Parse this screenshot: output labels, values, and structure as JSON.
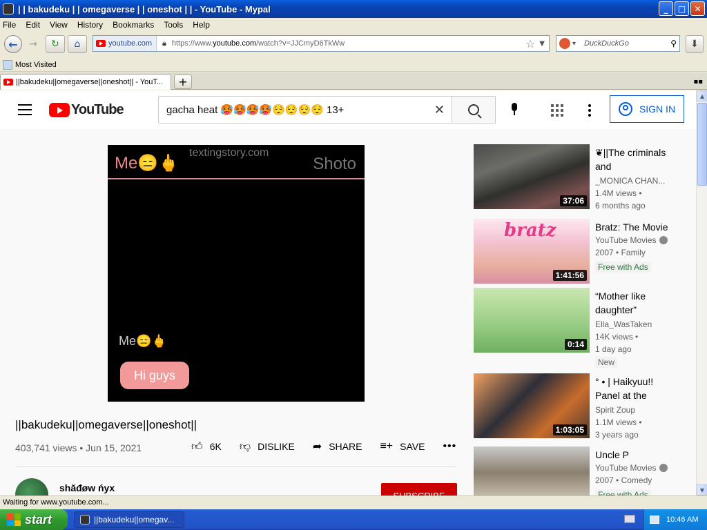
{
  "window": {
    "title": "| | bakudeku | | omegaverse | | oneshot | |  - YouTube - Mypal",
    "buttons": {
      "minimize": "_",
      "maximize": "□",
      "close": "✕"
    }
  },
  "menu": [
    "File",
    "Edit",
    "View",
    "History",
    "Bookmarks",
    "Tools",
    "Help"
  ],
  "nav": {
    "site_chip": "youtube.com",
    "url_prefix": "https://www.",
    "url_domain": "youtube.com",
    "url_path": "/watch?v=JJCmyD6TkWw",
    "search_placeholder": "DuckDuckGo"
  },
  "bookmarks": {
    "most_visited": "Most Visited"
  },
  "tabs": [
    {
      "label": "||bakudeku||omegaverse||oneshot|| - YouT..."
    }
  ],
  "youtube": {
    "logo_text": "YouTube",
    "search_query": "gacha heat 🥵🥵🥵🥵😌😌😌😌 13+",
    "sign_in": "SIGN IN"
  },
  "player": {
    "me_top": "Me😑🖕",
    "watermark": "textingstory.com",
    "contact": "Shoto",
    "me_mid": "Me😑🖕",
    "bubble": "Hi guys"
  },
  "video": {
    "title": "||bakudeku||omegaverse||oneshot||",
    "meta": "403,741 views • Jun 15, 2021",
    "likes": "6K",
    "dislike": "DISLIKE",
    "share": "SHARE",
    "save": "SAVE",
    "more": "•••",
    "channel": "shăđøw ńyx",
    "subscribe": "SUBSCRIBE"
  },
  "recommendations": [
    {
      "title": "❦||The criminals and",
      "channel": "_MONICA CHAN...",
      "views": "1.4M views •",
      "age": "6 months ago",
      "duration": "37:06"
    },
    {
      "title": "Bratz: The Movie",
      "channel": "YouTube Movies",
      "views": "2007 • Family",
      "badge": "Free with Ads",
      "duration": "1:41:56",
      "thumb_text": "bratz"
    },
    {
      "title": "“Mother like daughter”",
      "channel": "Ella_WasTaken",
      "views": "14K views •",
      "age": "1 day ago",
      "badge": "New",
      "duration": "0:14"
    },
    {
      "title": "° • | Haikyuu!! Panel at the",
      "channel": "Spirit Zoup",
      "views": "1.1M views •",
      "age": "3 years ago",
      "duration": "1:03:05"
    },
    {
      "title": "Uncle P",
      "channel": "YouTube Movies",
      "views": "2007 • Comedy",
      "badge": "Free with Ads"
    }
  ],
  "status": "Waiting for www.youtube.com...",
  "taskbar": {
    "start": "start",
    "item": "||bakudeku||omegav...",
    "clock": "10:46 AM"
  }
}
